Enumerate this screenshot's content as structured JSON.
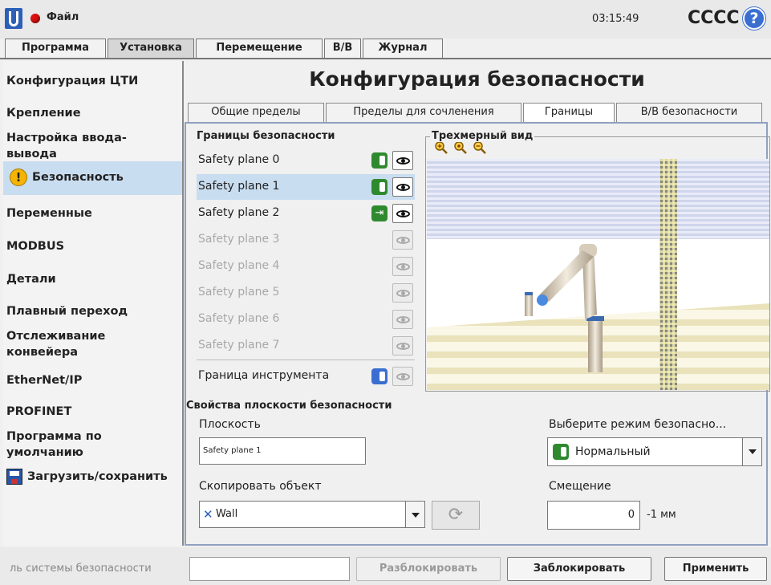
{
  "topbar": {
    "file_menu": "Файл",
    "clock": "03:15:49",
    "robot_name": "CCCC",
    "help_glyph": "?"
  },
  "main_tabs": [
    "Программа",
    "Установка",
    "Перемещение",
    "В/В",
    "Журнал"
  ],
  "sidebar": {
    "items": [
      "Конфигурация ЦТИ",
      "Крепление",
      "Настройка ввода-вывода",
      "Безопасность",
      "Переменные",
      "MODBUS",
      "Детали",
      "Плавный переход",
      "Отслеживание конвейера",
      "EtherNet/IP",
      "PROFINET",
      "Программа по умолчанию",
      "Загрузить/сохранить"
    ]
  },
  "main": {
    "title": "Конфигурация безопасности",
    "sub_tabs": [
      "Общие пределы",
      "Пределы для сочленения",
      "Границы",
      "В/В безопасности"
    ],
    "boundaries_title": "Границы безопасности",
    "planes": [
      {
        "label": "Safety plane 0",
        "enabled": true,
        "mode": "normal"
      },
      {
        "label": "Safety plane 1",
        "enabled": true,
        "mode": "normal"
      },
      {
        "label": "Safety plane 2",
        "enabled": true,
        "mode": "trigger"
      },
      {
        "label": "Safety plane 3",
        "enabled": false
      },
      {
        "label": "Safety plane 4",
        "enabled": false
      },
      {
        "label": "Safety plane 5",
        "enabled": false
      },
      {
        "label": "Safety plane 6",
        "enabled": false
      },
      {
        "label": "Safety plane 7",
        "enabled": false
      }
    ],
    "tool_boundary_label": "Граница инструмента",
    "view3d_title": "Трехмерный вид",
    "properties": {
      "title": "Свойства плоскости безопасности",
      "plane_label": "Плоскость",
      "plane_value": "Safety plane 1",
      "copy_label": "Скопировать объект",
      "copy_value": "Wall",
      "mode_label": "Выберите режим безопасно...",
      "mode_value": "Нормальный",
      "offset_label": "Смещение",
      "offset_value": "0",
      "offset_unit": "-1 мм"
    }
  },
  "bottombar": {
    "password_label": "ль системы безопасности",
    "unlock_label": "Разблокировать",
    "lock_label": "Заблокировать",
    "apply_label": "Применить"
  },
  "colors": {
    "selected_bg": "#c9ddf0",
    "switch_green": "#2f8a2f",
    "switch_blue": "#3a6fd1",
    "alert_red": "#dd1111",
    "warning_yellow": "#f5b400"
  }
}
